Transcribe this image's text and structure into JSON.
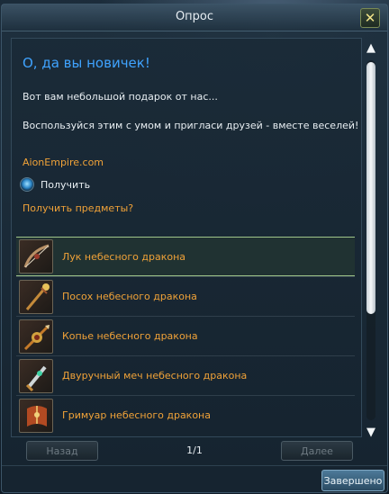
{
  "window": {
    "title": "Опрос",
    "close_glyph": "✕"
  },
  "content": {
    "heading": "О, да вы новичек!",
    "para1": "Вот вам небольшой подарок от нас...",
    "para2": "Воспользуйся этим с умом и пригласи друзей - вместе веселей!",
    "site": "AionEmpire.com",
    "radio_label": "Получить",
    "get_items_link": "Получить предметы?"
  },
  "items": [
    {
      "label": "Лук небесного дракона",
      "icon": "bow-icon",
      "selected": true
    },
    {
      "label": "Посох небесного дракона",
      "icon": "staff-icon",
      "selected": false
    },
    {
      "label": "Копье небесного дракона",
      "icon": "spear-icon",
      "selected": false
    },
    {
      "label": "Двуручный меч небесного дракона",
      "icon": "greatsword-icon",
      "selected": false
    },
    {
      "label": "Гримуар небесного дракона",
      "icon": "grimoire-icon",
      "selected": false
    }
  ],
  "pager": {
    "prev_label": "Назад",
    "next_label": "Далее",
    "count": "1/1"
  },
  "footer": {
    "done_label": "Завершено"
  },
  "colors": {
    "heading": "#3fa3ff",
    "accent_orange": "#f0a238",
    "text": "#e8eef2"
  }
}
